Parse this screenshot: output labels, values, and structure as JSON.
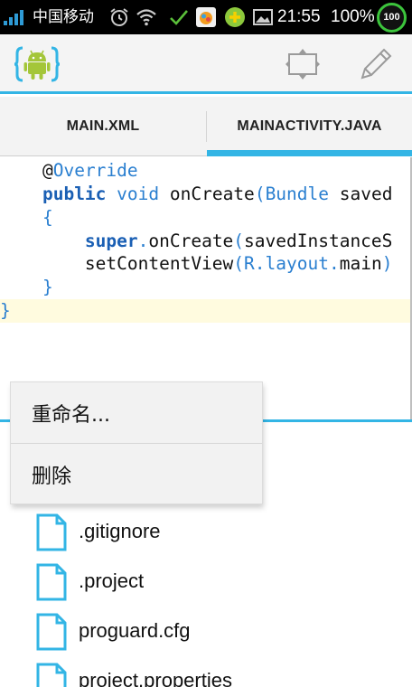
{
  "status_bar": {
    "carrier": "中国移动",
    "time": "21:55",
    "battery": "100%",
    "badge": "100",
    "icons": [
      "signal-icon",
      "alarm-icon",
      "wifi-icon",
      "check-icon",
      "app-notification-icon",
      "green-plus-icon",
      "image-icon"
    ]
  },
  "action_bar": {
    "logo": "android-brackets-logo",
    "buttons": [
      "switch-layout-icon",
      "edit-pencil-icon"
    ]
  },
  "tabs": [
    {
      "label": "MAIN.XML",
      "selected": false
    },
    {
      "label": "MAINACTIVITY.JAVA",
      "selected": true
    }
  ],
  "code": {
    "lines": [
      {
        "indent": "    ",
        "tokens": [
          {
            "t": "@",
            "c": "pl"
          },
          {
            "t": "Override",
            "c": "an"
          }
        ]
      },
      {
        "indent": "    ",
        "tokens": [
          {
            "t": "public",
            "c": "kw"
          },
          {
            "t": " ",
            "c": "pl"
          },
          {
            "t": "void",
            "c": "ty"
          },
          {
            "t": " onCreate",
            "c": "pl"
          },
          {
            "t": "(",
            "c": "pn"
          },
          {
            "t": "Bundle",
            "c": "ty"
          },
          {
            "t": " saved",
            "c": "pl"
          }
        ]
      },
      {
        "indent": "    ",
        "tokens": [
          {
            "t": "{",
            "c": "pn"
          }
        ]
      },
      {
        "indent": "        ",
        "tokens": [
          {
            "t": "super",
            "c": "kw"
          },
          {
            "t": ".",
            "c": "pn"
          },
          {
            "t": "onCreate",
            "c": "pl"
          },
          {
            "t": "(",
            "c": "pn"
          },
          {
            "t": "savedInstanceS",
            "c": "pl"
          }
        ]
      },
      {
        "indent": "        ",
        "tokens": [
          {
            "t": "setContentView",
            "c": "pl"
          },
          {
            "t": "(",
            "c": "pn"
          },
          {
            "t": "R",
            "c": "ty"
          },
          {
            "t": ".",
            "c": "pn"
          },
          {
            "t": "layout",
            "c": "ty"
          },
          {
            "t": ".",
            "c": "pn"
          },
          {
            "t": "main",
            "c": "pl"
          },
          {
            "t": ")",
            "c": "pn"
          }
        ]
      },
      {
        "indent": "    ",
        "tokens": [
          {
            "t": "}",
            "c": "pn"
          }
        ]
      },
      {
        "indent": "",
        "tokens": [
          {
            "t": "}",
            "c": "pn"
          }
        ],
        "active": true
      }
    ]
  },
  "context_menu": {
    "items": [
      {
        "label": "重命名..."
      },
      {
        "label": "删除"
      }
    ]
  },
  "files": [
    {
      "name": ".gitignore"
    },
    {
      "name": ".project"
    },
    {
      "name": "proguard.cfg"
    },
    {
      "name": "project.properties"
    }
  ],
  "colors": {
    "accent": "#33b5e5",
    "keyword": "#1a5fb4",
    "type": "#2a7fd0",
    "active_line": "#fffbdf",
    "android_green": "#a4c639"
  }
}
